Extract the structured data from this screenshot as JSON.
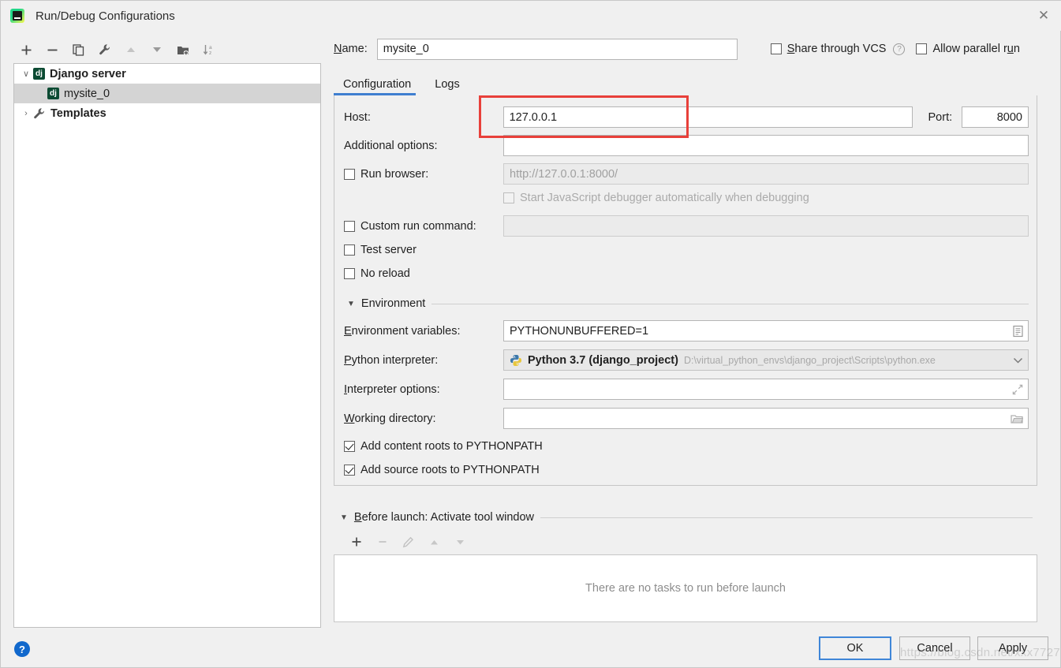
{
  "window": {
    "title": "Run/Debug Configurations",
    "app_icon": "pycharm-icon",
    "close_label": "✕"
  },
  "left_toolbar": {
    "buttons": [
      {
        "name": "add-configuration-button",
        "icon": "plus-icon",
        "glyph": "+",
        "enabled": true
      },
      {
        "name": "remove-configuration-button",
        "icon": "minus-icon",
        "glyph": "−",
        "enabled": true
      },
      {
        "name": "copy-configuration-button",
        "icon": "copy-icon",
        "glyph": "",
        "enabled": true
      },
      {
        "name": "edit-templates-button",
        "icon": "wrench-icon",
        "glyph": "",
        "enabled": true
      },
      {
        "name": "move-up-button",
        "icon": "arrow-up-icon",
        "glyph": "▲",
        "enabled": false
      },
      {
        "name": "move-down-button",
        "icon": "arrow-down-icon",
        "glyph": "▼",
        "enabled": true
      },
      {
        "name": "new-folder-button",
        "icon": "folder-add-icon",
        "glyph": "",
        "enabled": true
      },
      {
        "name": "sort-alphabetically-button",
        "icon": "sort-az-icon",
        "glyph": "",
        "enabled": true
      }
    ]
  },
  "tree": {
    "nodes": [
      {
        "label": "Django server",
        "icon": "django-icon",
        "twisty": "∨",
        "bold": true,
        "indent": 0,
        "selected": false
      },
      {
        "label": "mysite_0",
        "icon": "django-icon",
        "twisty": "",
        "bold": false,
        "indent": 1,
        "selected": true
      },
      {
        "label": "Templates",
        "icon": "wrench-icon",
        "twisty": "›",
        "bold": true,
        "indent": 0,
        "selected": false
      }
    ]
  },
  "name_row": {
    "label": "Name:",
    "label_mnemonic": "N",
    "value": "mysite_0",
    "share_vcs": {
      "label": "Share through VCS",
      "mnemonic": "S",
      "checked": false
    },
    "help_icon": "help-icon",
    "allow_parallel": {
      "label": "Allow parallel run",
      "mnemonic": "u",
      "checked": false
    }
  },
  "tabs": [
    {
      "label": "Configuration",
      "active": true
    },
    {
      "label": "Logs",
      "active": false
    }
  ],
  "configuration": {
    "host": {
      "label": "Host:",
      "value": "127.0.0.1"
    },
    "port": {
      "label": "Port:",
      "value": "8000"
    },
    "additional_options": {
      "label": "Additional options:",
      "value": ""
    },
    "run_browser": {
      "label": "Run browser:",
      "checked": false,
      "url": "http://127.0.0.1:8000/",
      "disabled": true
    },
    "start_js_debugger": {
      "label": "Start JavaScript debugger automatically when debugging",
      "checked": false,
      "disabled": true
    },
    "custom_run_command": {
      "label": "Custom run command:",
      "checked": false,
      "value": "",
      "disabled": true
    },
    "test_server": {
      "label": "Test server",
      "checked": false
    },
    "no_reload": {
      "label": "No reload",
      "checked": false
    },
    "environment": {
      "section_title": "Environment",
      "collapsed": false,
      "env_vars": {
        "label": "Environment variables:",
        "mnemonic": "E",
        "value": "PYTHONUNBUFFERED=1",
        "trailing_icon": "list-editor-icon"
      },
      "python_interpreter": {
        "label": "Python interpreter:",
        "mnemonic": "P",
        "icon": "python-icon",
        "value": "Python 3.7 (django_project)",
        "path": "D:\\virtual_python_envs\\django_project\\Scripts\\python.exe",
        "trailing_icon": "chevron-down-icon"
      },
      "interpreter_options": {
        "label": "Interpreter options:",
        "mnemonic": "I",
        "value": "",
        "trailing_icon": "expand-icon"
      },
      "working_directory": {
        "label": "Working directory:",
        "mnemonic": "W",
        "value": "",
        "trailing_icon": "folder-icon"
      },
      "add_content_roots": {
        "label": "Add content roots to PYTHONPATH",
        "checked": true
      },
      "add_source_roots": {
        "label": "Add source roots to PYTHONPATH",
        "checked": true
      }
    }
  },
  "before_launch": {
    "section_title": "Before launch: Activate tool window",
    "mnemonic": "B",
    "collapsed": false,
    "toolbar": [
      {
        "name": "add-task-button",
        "icon": "plus-icon",
        "glyph": "+",
        "enabled": true
      },
      {
        "name": "remove-task-button",
        "icon": "minus-icon",
        "glyph": "−",
        "enabled": false
      },
      {
        "name": "edit-task-button",
        "icon": "pencil-icon",
        "glyph": "",
        "enabled": false
      },
      {
        "name": "move-task-up",
        "icon": "arrow-up-icon",
        "glyph": "▲",
        "enabled": false
      },
      {
        "name": "move-task-down",
        "icon": "arrow-down-icon",
        "glyph": "▼",
        "enabled": false
      }
    ],
    "empty_text": "There are no tasks to run before launch"
  },
  "footer": {
    "help_icon": "help-icon",
    "help_glyph": "?",
    "buttons": [
      {
        "name": "ok-button",
        "label": "OK",
        "default": true
      },
      {
        "name": "cancel-button",
        "label": "Cancel",
        "default": false
      },
      {
        "name": "apply-button",
        "label": "Apply",
        "default": false
      }
    ]
  },
  "annotation": {
    "type": "highlight-rectangle",
    "color": "#e8403a",
    "target": "host-input"
  },
  "watermark": {
    "text": "https://blog.csdn.net/xxx7727"
  }
}
